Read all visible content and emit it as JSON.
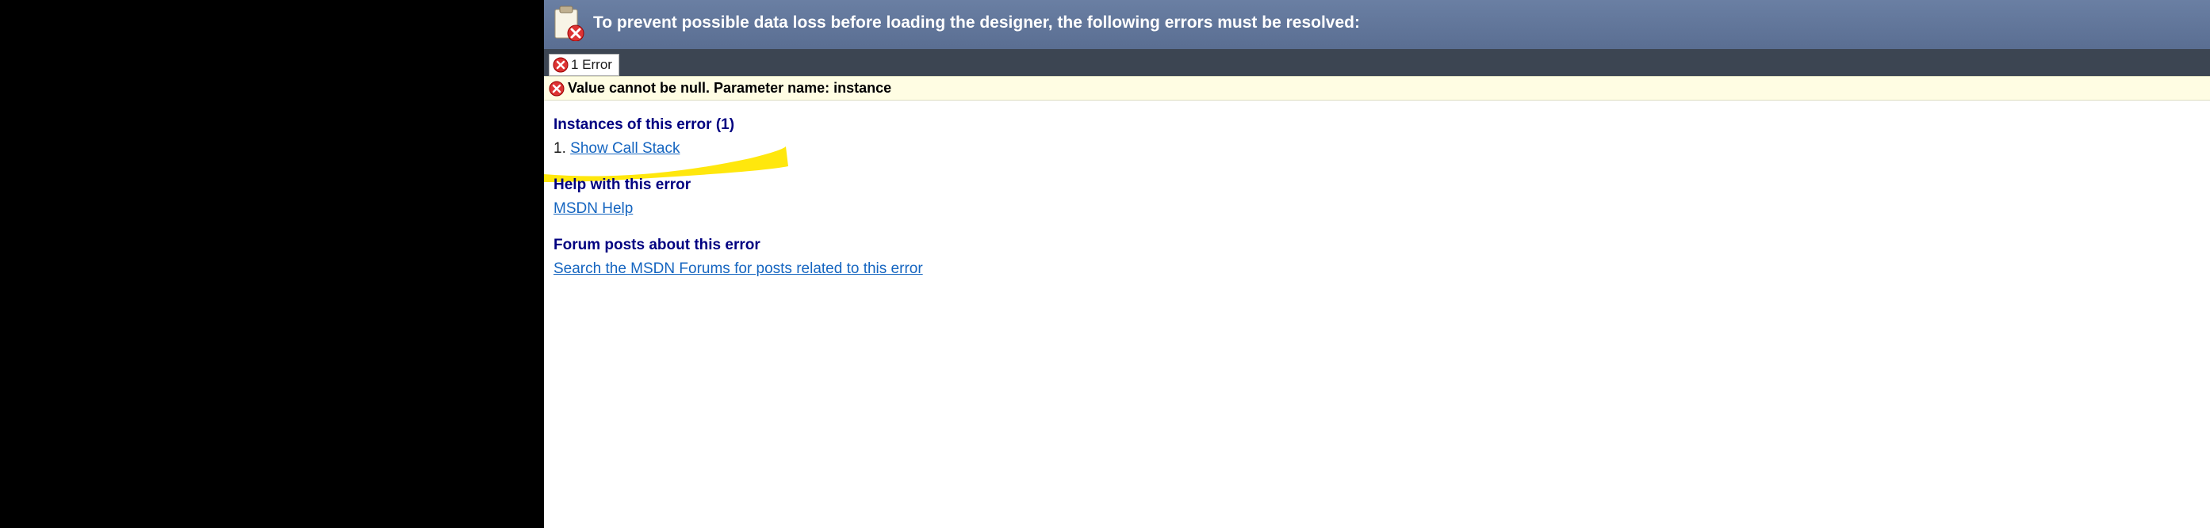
{
  "banner": {
    "title": "To prevent possible data loss before loading the designer, the following errors must be resolved:"
  },
  "tab": {
    "label": "1 Error"
  },
  "error_bar": {
    "message": "Value cannot be null. Parameter name: instance"
  },
  "sections": {
    "instances": {
      "heading": "Instances of this error (1)",
      "item_number": "1.",
      "link": "Show Call Stack"
    },
    "help": {
      "heading": "Help with this error",
      "link": "MSDN Help"
    },
    "forum": {
      "heading": "Forum posts about this error",
      "link": "Search the MSDN Forums for posts related to this error"
    }
  }
}
